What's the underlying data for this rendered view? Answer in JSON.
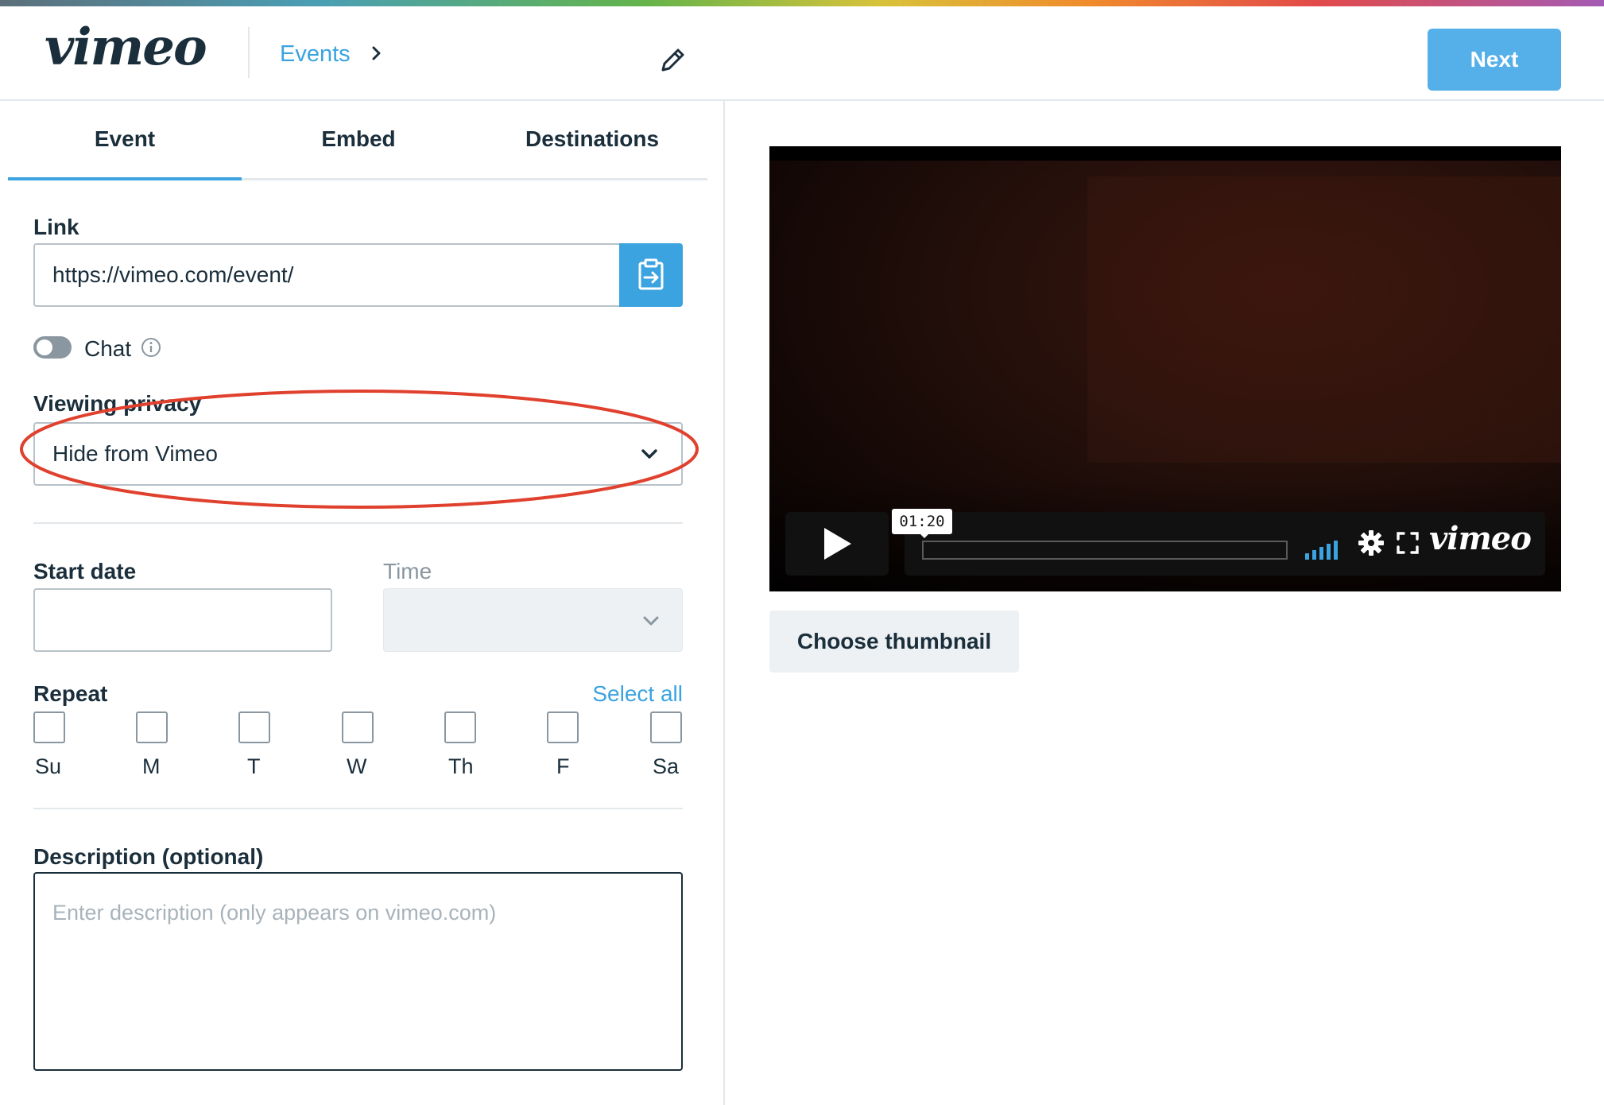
{
  "header": {
    "logo": "vimeo",
    "breadcrumb": "Events",
    "next_label": "Next"
  },
  "tabs": [
    {
      "label": "Event",
      "active": true
    },
    {
      "label": "Embed",
      "active": false
    },
    {
      "label": "Destinations",
      "active": false
    }
  ],
  "form": {
    "link_label": "Link",
    "link_value": "https://vimeo.com/event/",
    "chat_label": "Chat",
    "chat_enabled": false,
    "privacy_label": "Viewing privacy",
    "privacy_value": "Hide from Vimeo",
    "start_date_label": "Start date",
    "start_date_value": "",
    "time_label": "Time",
    "time_value": "",
    "repeat_label": "Repeat",
    "select_all_label": "Select all",
    "days": [
      "Su",
      "M",
      "T",
      "W",
      "Th",
      "F",
      "Sa"
    ],
    "description_label": "Description (optional)",
    "description_placeholder": "Enter description (only appears on vimeo.com)"
  },
  "player": {
    "time_tooltip": "01:20",
    "logo": "vimeo",
    "progress": 0.0
  },
  "thumbnail_button": "Choose thumbnail",
  "colors": {
    "accent": "#3ba3e0",
    "next_button": "#55b0ea",
    "text": "#1a2e3b",
    "highlight": "#e0412e"
  },
  "icons": [
    "pencil-icon",
    "chevron-right-icon",
    "clipboard-icon",
    "info-icon",
    "chevron-down-icon",
    "play-icon",
    "volume-icon",
    "gear-icon",
    "fullscreen-icon"
  ]
}
